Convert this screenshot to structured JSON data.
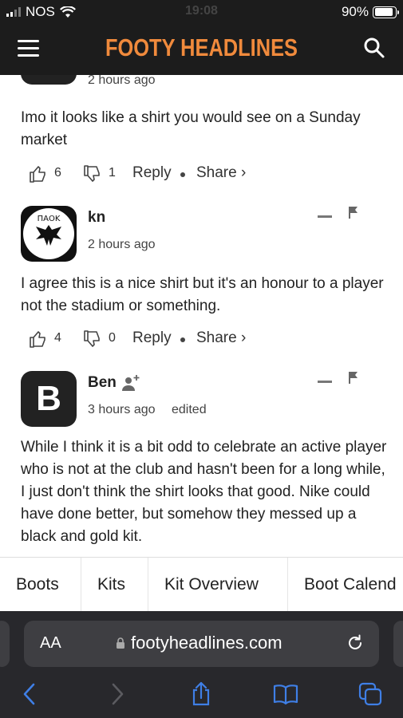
{
  "status_bar": {
    "carrier": "NOS",
    "time": "19:08",
    "battery": "90%",
    "battery_level": 0.9
  },
  "header": {
    "title": "FOOTY HEADLINES"
  },
  "comments": [
    {
      "time": "2 hours ago",
      "text": "Imo it looks like a shirt you would see on a Sunday market",
      "likes": "6",
      "dislikes": "1",
      "reply": "Reply",
      "share": "Share ›"
    },
    {
      "author": "kn",
      "time": "2 hours ago",
      "text": "I agree this is a nice shirt but it's an honour to a player not the stadium or something.",
      "likes": "4",
      "dislikes": "0",
      "reply": "Reply",
      "share": "Share ›"
    },
    {
      "author": "Ben",
      "avatar_letter": "B",
      "time": "3 hours ago",
      "edited": "edited",
      "text": "While I think it is a bit odd to celebrate an active player who is not at the club and hasn't been for a long while, I just don't think the shirt looks that good. Nike could have done better, but somehow they messed up a black and gold kit."
    }
  ],
  "category_nav": [
    "Boots",
    "Kits",
    "Kit Overview",
    "Boot Calend"
  ],
  "browser": {
    "aa": "AA",
    "url": "footyheadlines.com"
  },
  "colors": {
    "brand": "#f08a3c",
    "header_bg": "#1c1c1c",
    "toolbar_accent": "#3f7fe6"
  }
}
